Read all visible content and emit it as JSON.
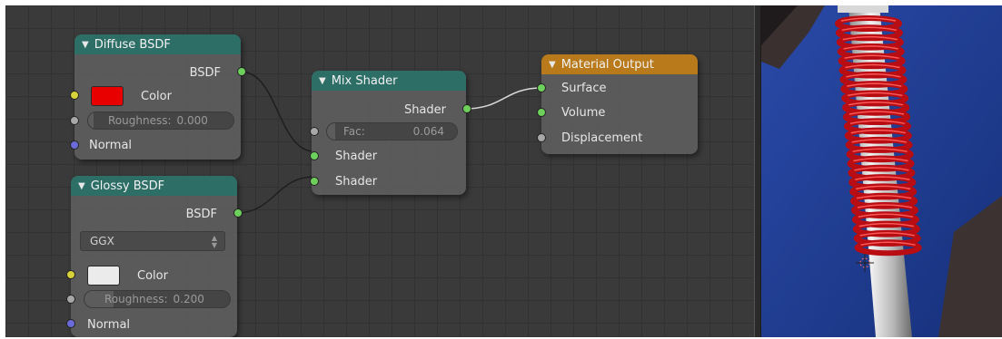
{
  "node_editor": {
    "nodes": {
      "diffuse": {
        "title": "Diffuse BSDF",
        "output_label": "BSDF",
        "color_label": "Color",
        "color_value": "#e80000",
        "roughness_label": "Roughness:",
        "roughness_value": "0.000",
        "normal_label": "Normal"
      },
      "glossy": {
        "title": "Glossy BSDF",
        "output_label": "BSDF",
        "distribution": "GGX",
        "color_label": "Color",
        "color_value": "#ebebeb",
        "roughness_label": "Roughness:",
        "roughness_value": "0.200",
        "normal_label": "Normal"
      },
      "mix": {
        "title": "Mix Shader",
        "output_label": "Shader",
        "fac_label": "Fac:",
        "fac_value": "0.064",
        "fac_fraction": 0.064,
        "input1_label": "Shader",
        "input2_label": "Shader"
      },
      "output": {
        "title": "Material Output",
        "surface_label": "Surface",
        "volume_label": "Volume",
        "displacement_label": "Displacement"
      }
    },
    "colors": {
      "header_teal": "#2d6e67",
      "header_orange": "#b87a1a",
      "socket_shader": "#6ed05c",
      "socket_color": "#d8d23a",
      "socket_value": "#a8a8a8",
      "socket_vector": "#6a6ad8"
    }
  },
  "viewport": {
    "object": "red coil spring on chrome shaft",
    "background": "#1f3c8f"
  }
}
